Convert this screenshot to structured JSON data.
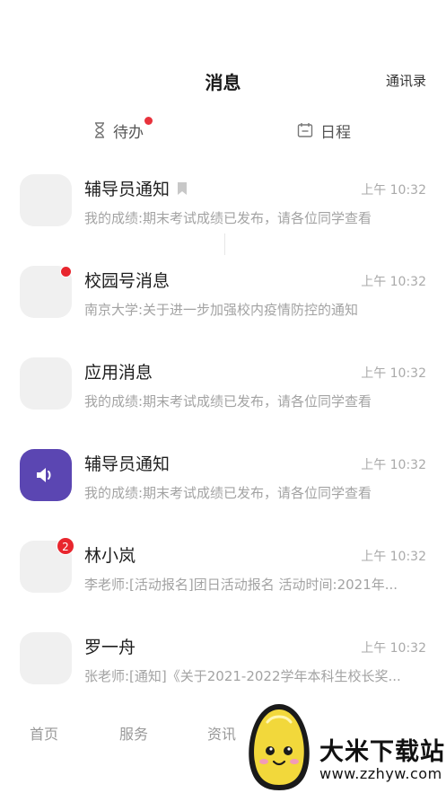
{
  "header": {
    "title": "消息",
    "contacts": "通讯录"
  },
  "subtabs": {
    "todo": "待办",
    "schedule": "日程"
  },
  "messages": [
    {
      "name": "辅导员通知",
      "time": "上午 10:32",
      "preview": "我的成绩:期末考试成绩已发布，请各位同学查看"
    },
    {
      "name": "校园号消息",
      "time": "上午 10:32",
      "preview": "南京大学:关于进一步加强校内疫情防控的通知"
    },
    {
      "name": "应用消息",
      "time": "上午 10:32",
      "preview": "我的成绩:期末考试成绩已发布，请各位同学查看"
    },
    {
      "name": "辅导员通知",
      "time": "上午 10:32",
      "preview": "我的成绩:期末考试成绩已发布，请各位同学查看"
    },
    {
      "name": "林小岚",
      "time": "上午 10:32",
      "preview": "李老师:[活动报名]团日活动报名 活动时间:2021年...",
      "badge": "2"
    },
    {
      "name": "罗一舟",
      "time": "上午 10:32",
      "preview": "张老师:[通知]《关于2021-2022学年本科生校长奖..."
    }
  ],
  "bottom_nav": {
    "home": "首页",
    "services": "服务",
    "news": "资讯"
  },
  "watermark": {
    "brand": "大米下载站",
    "url": "www.zzhyw.com"
  },
  "colors": {
    "accent_purple": "#5b46b2",
    "badge_red": "#e8262e"
  }
}
